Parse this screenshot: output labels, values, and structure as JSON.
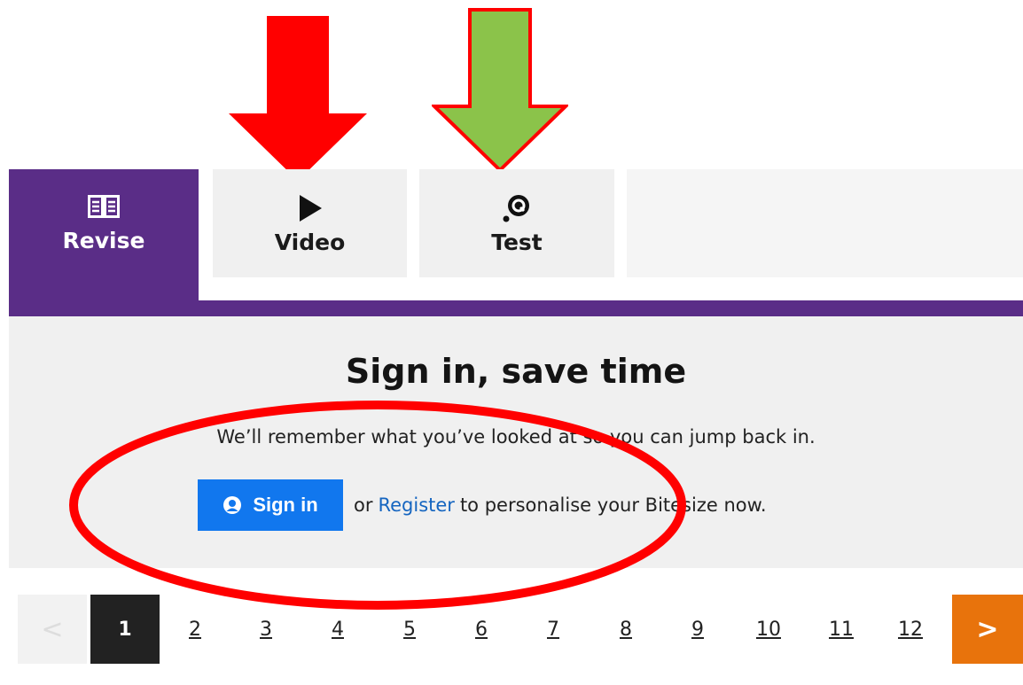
{
  "tabs": [
    {
      "label": "Revise",
      "icon": "book-icon",
      "active": true
    },
    {
      "label": "Video",
      "icon": "play-icon",
      "active": false
    },
    {
      "label": "Test",
      "icon": "quiz-icon",
      "active": false
    }
  ],
  "signin": {
    "title": "Sign in, save time",
    "description": "We’ll remember what you’ve looked at so you can jump back in.",
    "button_label": "Sign in",
    "or_text": "or",
    "register_label": "Register",
    "tail_text": "to personalise your Bitesize now."
  },
  "pagination": {
    "prev": "<",
    "current": "1",
    "pages": [
      "2",
      "3",
      "4",
      "5",
      "6",
      "7",
      "8",
      "9",
      "10",
      "11",
      "12"
    ],
    "next": ">"
  },
  "colors": {
    "active_tab": "#5a2d87",
    "sign_in_button": "#1177ee",
    "register_link": "#1565c0",
    "next_button": "#e8730c",
    "annotation_red": "#ff0000",
    "annotation_green": "#8bc34a"
  }
}
